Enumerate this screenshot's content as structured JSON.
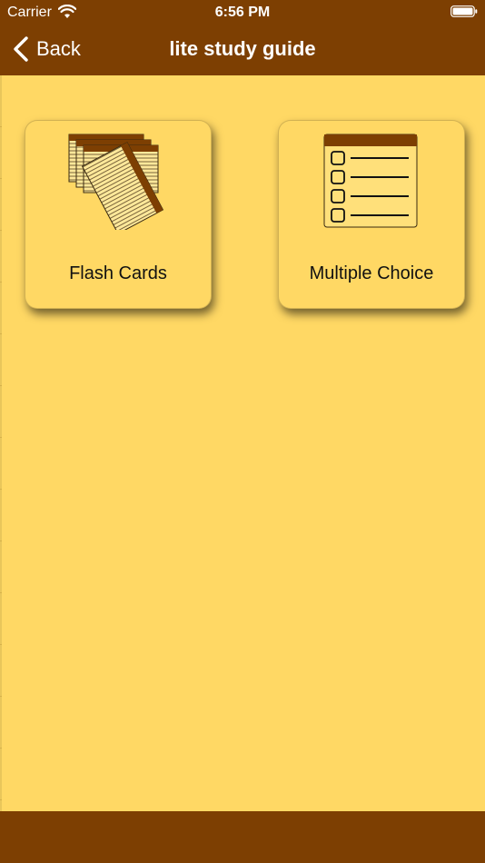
{
  "status_bar": {
    "carrier": "Carrier",
    "time": "6:56 PM",
    "wifi_icon": "wifi-icon",
    "battery_icon": "battery-icon"
  },
  "nav": {
    "back_label": "Back",
    "title": "lite study guide"
  },
  "menu": {
    "items": [
      {
        "label": "Flash Cards",
        "icon": "flash-cards-icon"
      },
      {
        "label": "Multiple Choice",
        "icon": "multiple-choice-icon"
      }
    ]
  },
  "colors": {
    "brand": "#7D3F02",
    "background": "#FFD864",
    "text_light": "#FFFFFF"
  }
}
